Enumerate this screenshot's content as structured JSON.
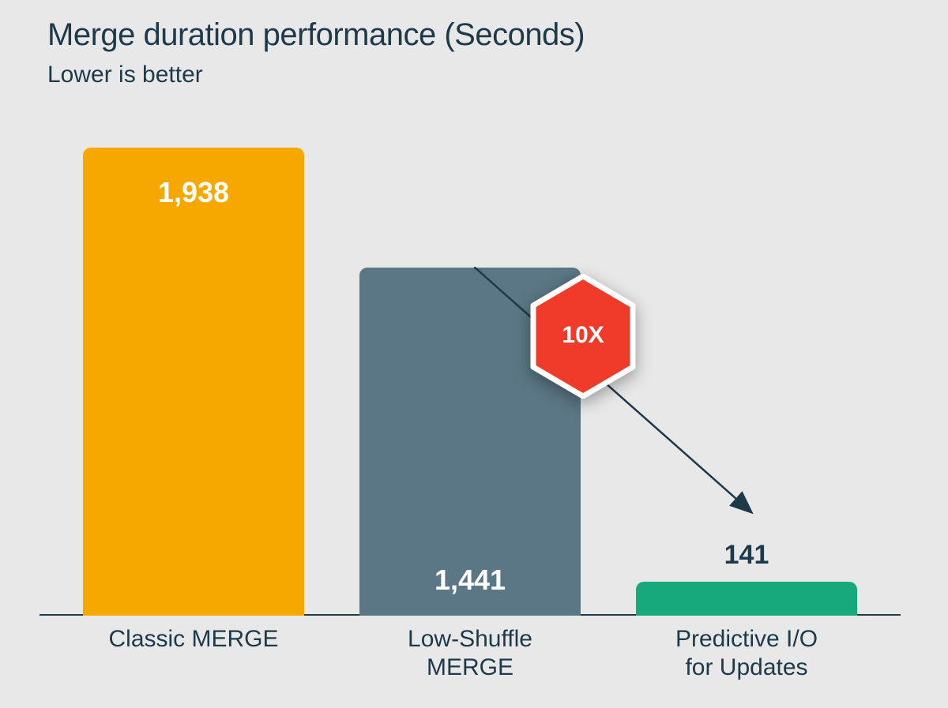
{
  "chart_data": {
    "type": "bar",
    "title": "Merge duration performance (Seconds)",
    "subtitle": "Lower is better",
    "xlabel": "",
    "ylabel": "",
    "ylim": [
      0,
      2000
    ],
    "categories": [
      "Classic MERGE",
      "Low-Shuffle MERGE",
      "Predictive I/O for Updates"
    ],
    "values": [
      1938,
      1441,
      141
    ],
    "value_labels": [
      "1,938",
      "1,441",
      "141"
    ],
    "colors": [
      "#f6a800",
      "#5b7785",
      "#17a87b"
    ],
    "annotation": {
      "badge_text": "10X",
      "badge_color": "#f03b2a",
      "from_category_index": 1,
      "to_category_index": 2
    }
  }
}
